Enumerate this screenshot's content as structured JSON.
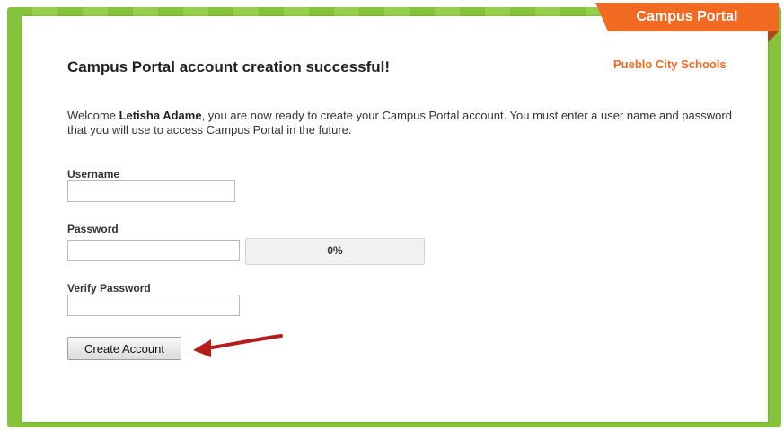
{
  "header": {
    "ribbon_label": "Campus Portal",
    "district_name": "Pueblo City Schools"
  },
  "main": {
    "title": "Campus Portal account creation successful!",
    "welcome_prefix": "Welcome ",
    "user_name": "Letisha Adame",
    "welcome_suffix": ", you are now ready to create your Campus Portal account. You must enter a user name and password that you will use to access Campus Portal in the future."
  },
  "form": {
    "username_label": "Username",
    "username_value": "",
    "password_label": "Password",
    "password_value": "",
    "strength_percent": 0,
    "strength_text": "0%",
    "verify_label": "Verify Password",
    "verify_value": "",
    "submit_label": "Create Account"
  },
  "annotation": {
    "arrow_icon": "red-arrow-icon"
  },
  "colors": {
    "frame_green": "#86c23b",
    "accent_orange": "#f26a21",
    "arrow_red": "#b71c1c"
  }
}
